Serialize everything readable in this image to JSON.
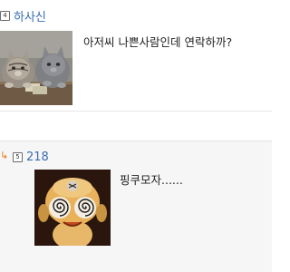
{
  "comments": [
    {
      "level": "4",
      "author": "하사신",
      "text": "아저씨 나쁜사람인데 연락하까?",
      "image_alt": "cats-playing-cards"
    },
    {
      "level": "5",
      "author": "218",
      "text": "핑쿠모자......",
      "image_alt": "frog-character-with-swirl-eyes"
    }
  ],
  "colors": {
    "author": "#3a6db0",
    "reply_arrow": "#e07a1f",
    "reply_bg": "#f6f6f6"
  }
}
